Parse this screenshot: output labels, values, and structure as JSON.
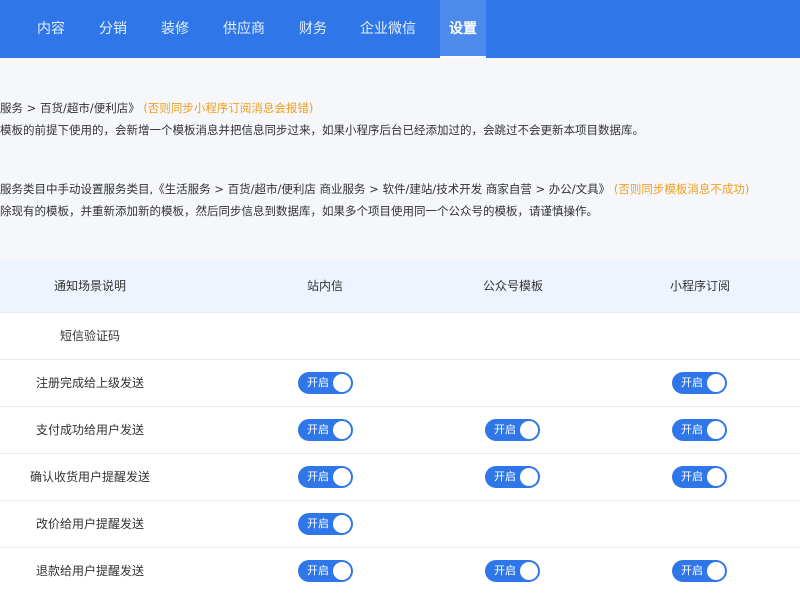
{
  "nav": {
    "items": [
      "内容",
      "分销",
      "装修",
      "供应商",
      "财务",
      "企业微信",
      "设置"
    ],
    "active": "设置"
  },
  "notes": {
    "line1_main": "服务 > 百货/超市/便利店》",
    "line1_warn": "(否则同步小程序订阅消息会报错)",
    "line2": "模板的前提下使用的，会新增一个模板消息并把信息同步过来，如果小程序后台已经添加过的，会跳过不会更新本项目数据库。",
    "line3_main": "服务类目中手动设置服务类目,《生活服务 > 百货/超市/便利店 商业服务 > 软件/建站/技术开发 商家自营 > 办公/文具》",
    "line3_warn": "(否则同步模板消息不成功)",
    "line4": "除现有的模板，并重新添加新的模板，然后同步信息到数据库，如果多个项目使用同一个公众号的模板，请谨慎操作。"
  },
  "table": {
    "headers": [
      "通知场景说明",
      "站内信",
      "公众号模板",
      "小程序订阅"
    ],
    "toggle_label": "开启",
    "rows": [
      {
        "label": "短信验证码",
        "site": false,
        "mp": false,
        "mini": false
      },
      {
        "label": "注册完成给上级发送",
        "site": true,
        "mp": false,
        "mini": true
      },
      {
        "label": "支付成功给用户发送",
        "site": true,
        "mp": true,
        "mini": true
      },
      {
        "label": "确认收货用户提醒发送",
        "site": true,
        "mp": true,
        "mini": true
      },
      {
        "label": "改价给用户提醒发送",
        "site": true,
        "mp": false,
        "mini": false
      },
      {
        "label": "退款给用户提醒发送",
        "site": true,
        "mp": true,
        "mini": true
      }
    ]
  },
  "colors": {
    "primary": "#2f77e9",
    "warning": "#f0a020",
    "header_bg": "#edf4fd"
  }
}
